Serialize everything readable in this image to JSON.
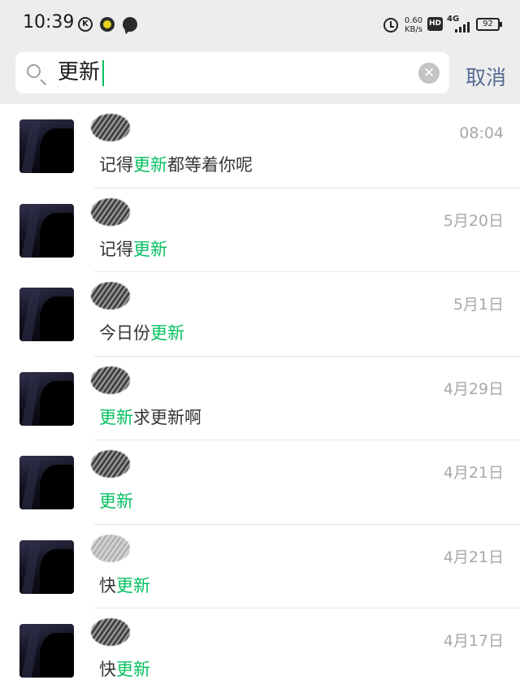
{
  "status_bar": {
    "time": "10:39",
    "k_icon": "K",
    "net_speed_value": "0.60",
    "net_speed_unit": "KB/s",
    "hd_label": "HD",
    "network_label": "4G",
    "battery": "92"
  },
  "search": {
    "query": "更新",
    "cancel_label": "取消"
  },
  "colors": {
    "highlight": "#07c160",
    "cancel": "#576b95",
    "timestamp": "#a8a8a8"
  },
  "results": [
    {
      "time": "08:04",
      "before": "记得",
      "match": "更新",
      "after": "都等着你呢"
    },
    {
      "time": "5月20日",
      "before": "记得",
      "match": "更新",
      "after": ""
    },
    {
      "time": "5月1日",
      "before": "今日份",
      "match": "更新",
      "after": ""
    },
    {
      "time": "4月29日",
      "before": "",
      "match": "更新",
      "after": "求更新啊"
    },
    {
      "time": "4月21日",
      "before": "",
      "match": "更新",
      "after": ""
    },
    {
      "time": "4月21日",
      "before": "快",
      "match": "更新",
      "after": ""
    },
    {
      "time": "4月17日",
      "before": "快",
      "match": "更新",
      "after": ""
    }
  ]
}
